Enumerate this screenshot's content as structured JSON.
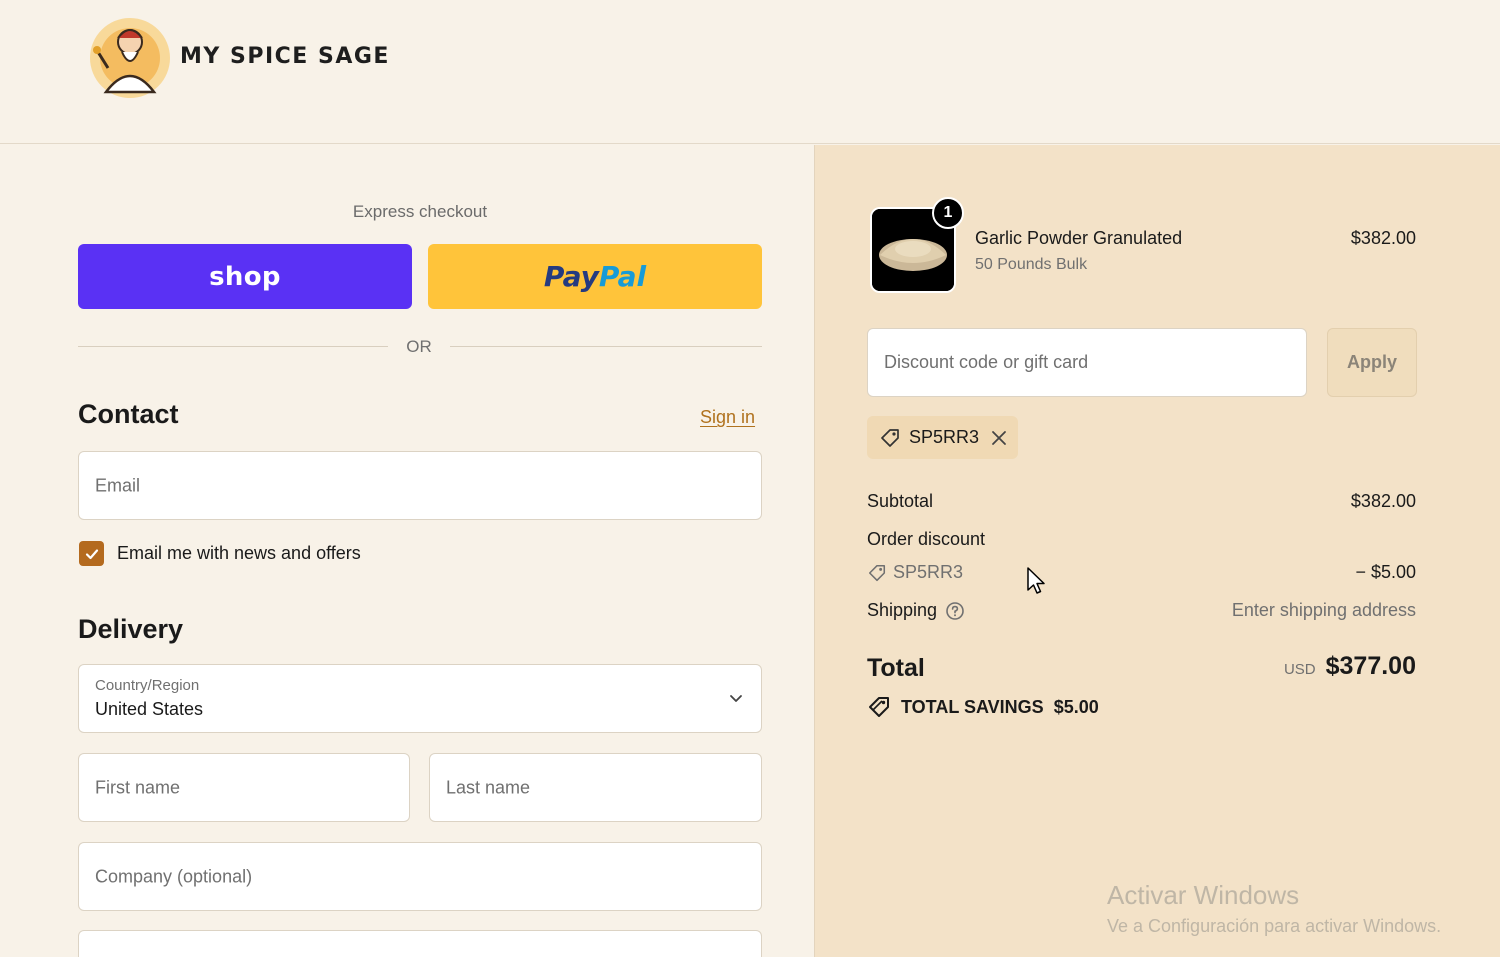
{
  "brand": {
    "name": "MY SPICE SAGE"
  },
  "express": {
    "label": "Express checkout",
    "shop_label": "shop",
    "paypal_a": "Pay",
    "paypal_b": "Pal",
    "or_label": "OR"
  },
  "contact": {
    "title": "Contact",
    "sign_in": "Sign in",
    "email_placeholder": "Email",
    "newsletter_label": "Email me with news and offers",
    "newsletter_checked": true
  },
  "delivery": {
    "title": "Delivery",
    "country_label": "Country/Region",
    "country_value": "United States",
    "first_name_placeholder": "First name",
    "last_name_placeholder": "Last name",
    "company_placeholder": "Company (optional)"
  },
  "order": {
    "item": {
      "name": "Garlic Powder Granulated",
      "variant": "50 Pounds Bulk",
      "price": "$382.00",
      "quantity": "1"
    },
    "discount_placeholder": "Discount code or gift card",
    "apply_label": "Apply",
    "applied_code": "SP5RR3",
    "subtotal_label": "Subtotal",
    "subtotal_value": "$382.00",
    "order_discount_label": "Order discount",
    "discount_code": "SP5RR3",
    "discount_value": "− $5.00",
    "shipping_label": "Shipping",
    "shipping_value": "Enter shipping address",
    "total_label": "Total",
    "currency": "USD",
    "total_value": "$377.00",
    "savings_label": "TOTAL SAVINGS",
    "savings_value": "$5.00"
  },
  "watermark": {
    "line1": "Activar Windows",
    "line2": "Ve a Configuración para activar Windows."
  },
  "colors": {
    "shop_purple": "#5a31f4",
    "paypal_yellow": "#ffc43a",
    "accent": "#b46a1e",
    "summary_bg": "#f3e2c8"
  }
}
